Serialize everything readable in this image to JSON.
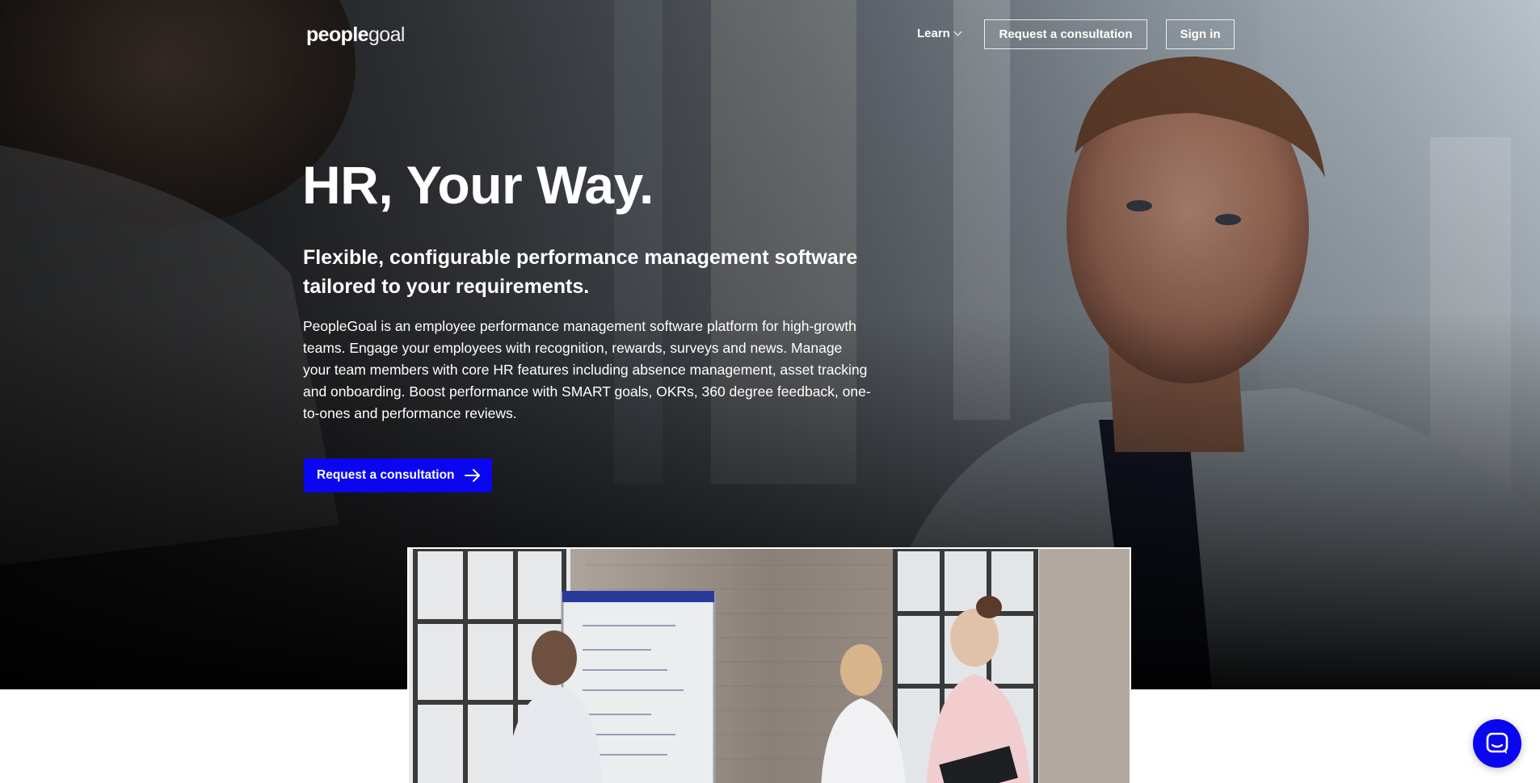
{
  "brand": {
    "logo_part1": "people",
    "logo_part2": "goal",
    "accent_color": "#0a06f0"
  },
  "nav": {
    "learn_label": "Learn",
    "consult_label": "Request a consultation",
    "signin_label": "Sign in"
  },
  "hero": {
    "title": "HR, Your Way.",
    "subtitle": "Flexible, configurable performance management software tailored to your requirements.",
    "description": "PeopleGoal is an employee performance management software platform for high-growth teams. Engage your employees with recognition, rewards, surveys and news. Manage your team members with core HR features including absence management, asset tracking and onboarding. Boost performance with SMART goals, OKRs, 360 degree feedback, one-to-ones and performance reviews.",
    "cta_label": "Request a consultation"
  },
  "icons": {
    "cta_icon": "arrow-right-icon",
    "learn_icon": "chevron-down-icon",
    "chat_icon": "chat-bubble-icon"
  }
}
